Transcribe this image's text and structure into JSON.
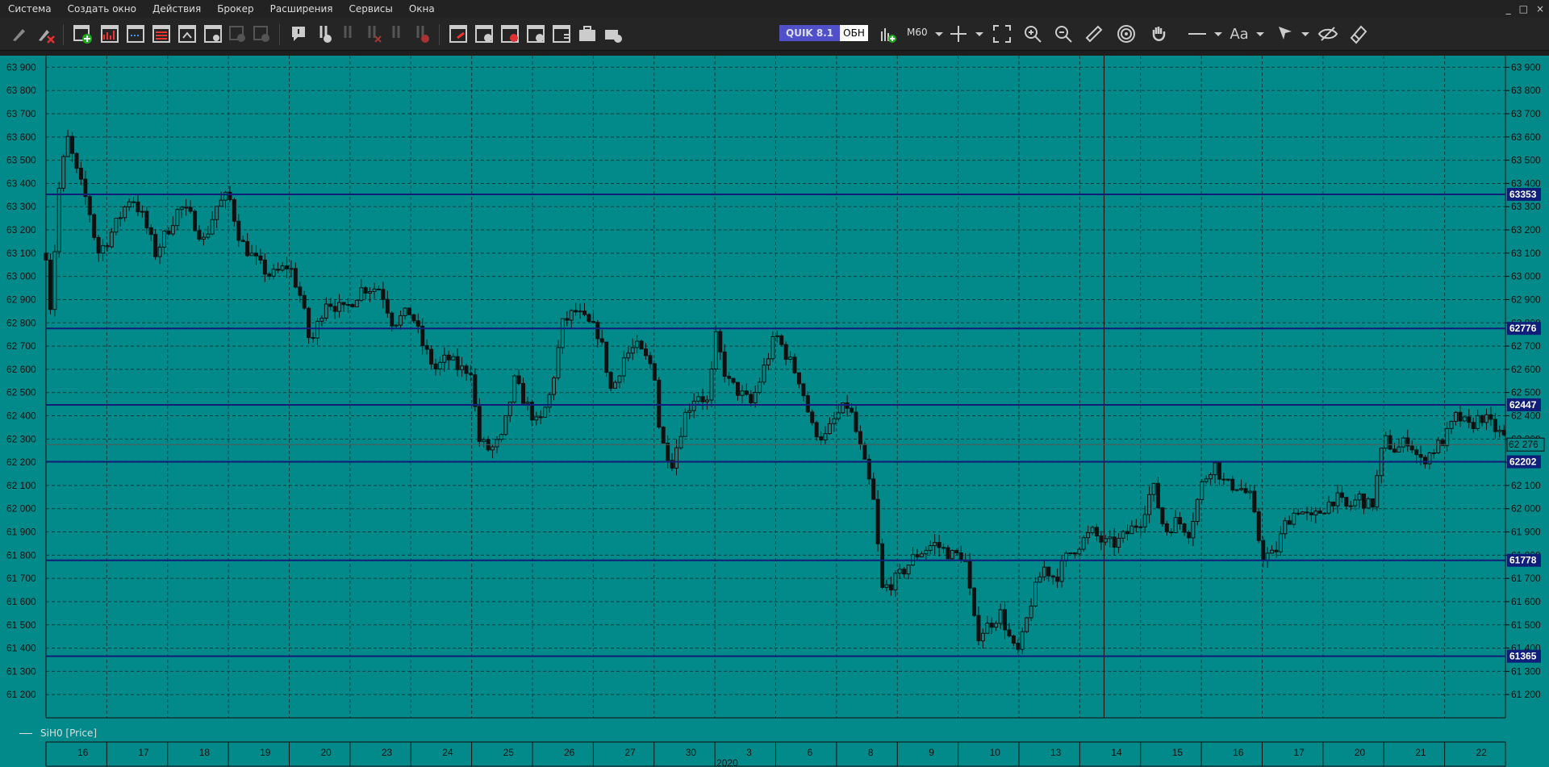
{
  "menu": [
    "Система",
    "Создать окно",
    "Действия",
    "Брокер",
    "Расширения",
    "Сервисы",
    "Окна"
  ],
  "window_controls": [
    "_",
    "□",
    "×"
  ],
  "toolbar": {
    "quik_label": "QUIK 8.1",
    "mode_label": "ОБН",
    "interval": "M60",
    "font_label": "Aa"
  },
  "colors": {
    "chart_bg": "#028a8a",
    "grid": "#0a3f3f",
    "candle": "#101010",
    "level_line": "#0f1e78",
    "level_label_bg": "#0f1e78",
    "text": "#101010"
  },
  "legend": {
    "series": "SiH0 [Price]"
  },
  "chart_data": {
    "type": "candlestick",
    "title": "",
    "ylabel": "",
    "xlabel": "",
    "ylim": [
      61100,
      63950
    ],
    "y_ticks": [
      61200,
      61300,
      61400,
      61500,
      61600,
      61700,
      61800,
      61900,
      62000,
      62100,
      62200,
      62300,
      62400,
      62500,
      62600,
      62700,
      62800,
      62900,
      63000,
      63100,
      63200,
      63300,
      63400,
      63500,
      63600,
      63700,
      63800,
      63900
    ],
    "y_tick_labels": [
      "61 200",
      "61 300",
      "61 400",
      "61 500",
      "61 600",
      "61 700",
      "61 800",
      "61 900",
      "62 000",
      "62 100",
      "62 200",
      "62 300",
      "62 400",
      "62 500",
      "62 600",
      "62 700",
      "62 800",
      "62 900",
      "63 000",
      "63 100",
      "63 200",
      "63 300",
      "63 400",
      "63 500",
      "63 600",
      "63 700",
      "63 800",
      "63 900"
    ],
    "x_days": [
      "16",
      "17",
      "18",
      "19",
      "20",
      "23",
      "24",
      "25",
      "26",
      "27",
      "30",
      "3",
      "6",
      "8",
      "9",
      "10",
      "13",
      "14",
      "15",
      "16",
      "17",
      "20",
      "21",
      "22"
    ],
    "x_year_label": "2020",
    "x_year_after_day_index": 11,
    "levels": [
      {
        "value": 63353,
        "label": "63353"
      },
      {
        "value": 62776,
        "label": "62776"
      },
      {
        "value": 62447,
        "label": "62447"
      },
      {
        "value": 62202,
        "label": "62202"
      },
      {
        "value": 61778,
        "label": "61778"
      },
      {
        "value": 61365,
        "label": "61365"
      }
    ],
    "current_price": {
      "value": 62276,
      "label": "62 276"
    },
    "crosshair_day_index": 17.4,
    "close_path": [
      [
        0.0,
        63100
      ],
      [
        0.08,
        62850
      ],
      [
        0.2,
        63350
      ],
      [
        0.35,
        63600
      ],
      [
        0.5,
        63450
      ],
      [
        0.7,
        63300
      ],
      [
        0.85,
        63100
      ],
      [
        1.0,
        63150
      ],
      [
        1.2,
        63250
      ],
      [
        1.4,
        63350
      ],
      [
        1.6,
        63250
      ],
      [
        1.8,
        63100
      ],
      [
        2.0,
        63200
      ],
      [
        2.2,
        63300
      ],
      [
        2.4,
        63250
      ],
      [
        2.6,
        63150
      ],
      [
        2.8,
        63300
      ],
      [
        3.0,
        63350
      ],
      [
        3.2,
        63150
      ],
      [
        3.5,
        63050
      ],
      [
        3.7,
        63000
      ],
      [
        4.0,
        63050
      ],
      [
        4.2,
        62900
      ],
      [
        4.35,
        62700
      ],
      [
        4.6,
        62900
      ],
      [
        4.9,
        62850
      ],
      [
        5.2,
        62950
      ],
      [
        5.5,
        62950
      ],
      [
        5.7,
        62800
      ],
      [
        6.0,
        62850
      ],
      [
        6.2,
        62700
      ],
      [
        6.4,
        62600
      ],
      [
        6.6,
        62650
      ],
      [
        6.8,
        62600
      ],
      [
        7.0,
        62600
      ],
      [
        7.1,
        62300
      ],
      [
        7.3,
        62250
      ],
      [
        7.5,
        62300
      ],
      [
        7.7,
        62550
      ],
      [
        7.9,
        62450
      ],
      [
        8.1,
        62350
      ],
      [
        8.3,
        62500
      ],
      [
        8.5,
        62800
      ],
      [
        8.7,
        62850
      ],
      [
        8.9,
        62800
      ],
      [
        9.1,
        62750
      ],
      [
        9.3,
        62500
      ],
      [
        9.5,
        62650
      ],
      [
        9.7,
        62700
      ],
      [
        10.0,
        62600
      ],
      [
        10.1,
        62300
      ],
      [
        10.3,
        62200
      ],
      [
        10.5,
        62400
      ],
      [
        10.7,
        62500
      ],
      [
        10.9,
        62450
      ],
      [
        11.0,
        62750
      ],
      [
        11.2,
        62550
      ],
      [
        11.4,
        62500
      ],
      [
        11.6,
        62450
      ],
      [
        11.8,
        62600
      ],
      [
        12.0,
        62750
      ],
      [
        12.2,
        62650
      ],
      [
        12.4,
        62550
      ],
      [
        12.6,
        62350
      ],
      [
        12.8,
        62300
      ],
      [
        13.0,
        62400
      ],
      [
        13.2,
        62450
      ],
      [
        13.4,
        62250
      ],
      [
        13.6,
        62050
      ],
      [
        13.75,
        61650
      ],
      [
        14.0,
        61700
      ],
      [
        14.3,
        61800
      ],
      [
        14.6,
        61850
      ],
      [
        14.9,
        61800
      ],
      [
        15.1,
        61800
      ],
      [
        15.3,
        61450
      ],
      [
        15.5,
        61500
      ],
      [
        15.7,
        61550
      ],
      [
        15.9,
        61400
      ],
      [
        16.0,
        61380
      ],
      [
        16.2,
        61600
      ],
      [
        16.4,
        61750
      ],
      [
        16.6,
        61700
      ],
      [
        16.8,
        61800
      ],
      [
        17.0,
        61850
      ],
      [
        17.2,
        61900
      ],
      [
        17.4,
        61850
      ],
      [
        17.6,
        61850
      ],
      [
        17.8,
        61900
      ],
      [
        18.0,
        61950
      ],
      [
        18.2,
        62100
      ],
      [
        18.4,
        61900
      ],
      [
        18.6,
        61950
      ],
      [
        18.8,
        61900
      ],
      [
        19.0,
        62100
      ],
      [
        19.2,
        62200
      ],
      [
        19.4,
        62100
      ],
      [
        19.6,
        62100
      ],
      [
        19.8,
        62050
      ],
      [
        20.0,
        61800
      ],
      [
        20.2,
        61800
      ],
      [
        20.4,
        61950
      ],
      [
        20.6,
        62000
      ],
      [
        20.8,
        61950
      ],
      [
        21.0,
        62000
      ],
      [
        21.2,
        62050
      ],
      [
        21.4,
        62000
      ],
      [
        21.6,
        62050
      ],
      [
        21.8,
        62000
      ],
      [
        22.0,
        62300
      ],
      [
        22.2,
        62250
      ],
      [
        22.4,
        62300
      ],
      [
        22.6,
        62200
      ],
      [
        22.8,
        62250
      ],
      [
        23.0,
        62300
      ],
      [
        23.2,
        62400
      ],
      [
        23.4,
        62350
      ],
      [
        23.6,
        62400
      ],
      [
        23.8,
        62350
      ],
      [
        24.0,
        62300
      ]
    ]
  }
}
